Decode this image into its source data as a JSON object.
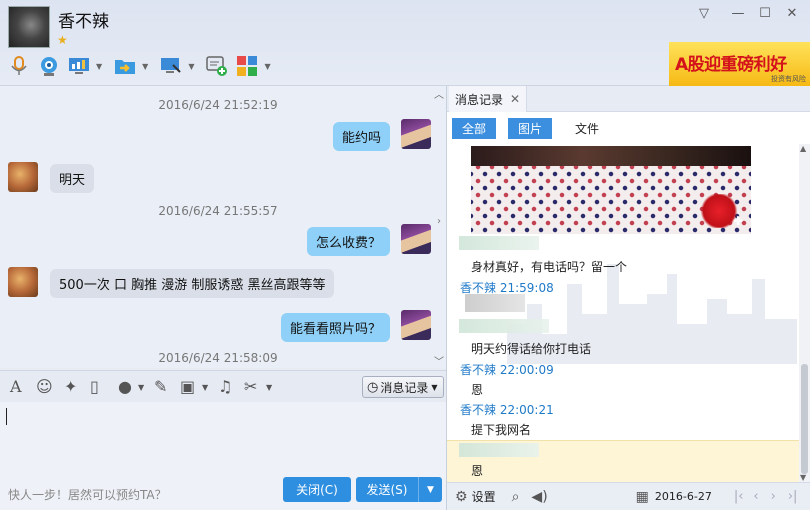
{
  "contact": {
    "name": "香不辣",
    "star": "★"
  },
  "window": {
    "minimize_dropdown": "▽",
    "minimize": "—",
    "maximize": "☐",
    "close": "✕"
  },
  "ad": {
    "text": "A股迎重磅利好",
    "sub": "投资有风险"
  },
  "chat": {
    "messages": [
      {
        "timestamp": "2016/6/24 21:52:19",
        "side": "right",
        "text": "能约吗"
      },
      {
        "side": "left",
        "text": "明天"
      },
      {
        "timestamp": "2016/6/24 21:55:57",
        "side": "right",
        "text": "怎么收费？"
      },
      {
        "side": "left",
        "text": "500一次   口 胸推  漫游   制服诱惑    黑丝高跟等等"
      },
      {
        "side": "right",
        "text": "能看看照片吗？"
      },
      {
        "timestamp": "2016/6/24 21:58:09"
      }
    ]
  },
  "input_toolbar": {
    "message_log": "消息记录"
  },
  "footer": {
    "hint": "快人一步！居然可以预约TA？",
    "close": "关闭(C)",
    "send": "发送(S)"
  },
  "history": {
    "tab_title": "消息记录",
    "filters": [
      "全部",
      "图片",
      "文件"
    ],
    "entries": [
      {
        "text": "身材真好，有电话吗？留一个"
      },
      {
        "meta": "香不辣 21:59:08"
      },
      {
        "text": "明天约得话给你打电话"
      },
      {
        "meta": "香不辣 22:00:09"
      },
      {
        "text": "恩"
      },
      {
        "meta": "香不辣 22:00:21"
      },
      {
        "text": "提下我网名"
      },
      {
        "text": "恩"
      }
    ],
    "settings": "设置",
    "date": "2016-6-27"
  },
  "colors": {
    "accent": "#2e8fe0",
    "bubble_right": "#8ed0f7",
    "bubble_left": "#d9dee8",
    "meta_name": "#1f7ac8"
  }
}
